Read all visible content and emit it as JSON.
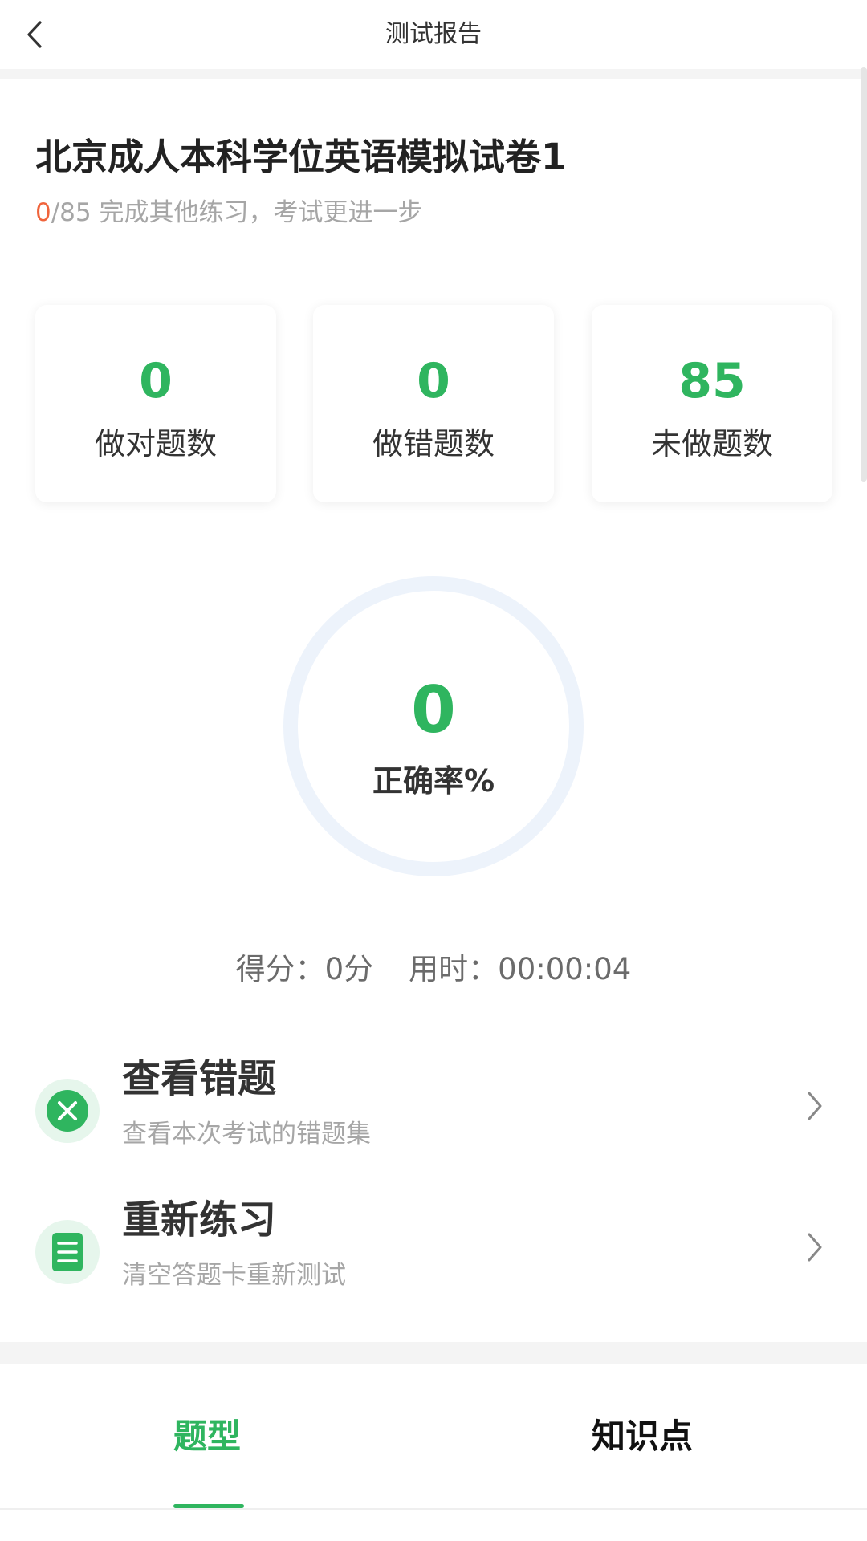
{
  "header": {
    "title": "测试报告"
  },
  "exam": {
    "title": "北京成人本科学位英语模拟试卷1",
    "completed": "0",
    "total_part": "/85",
    "progress_hint": " 完成其他练习，考试更进一步"
  },
  "stats": [
    {
      "value": "0",
      "label": "做对题数"
    },
    {
      "value": "0",
      "label": "做错题数"
    },
    {
      "value": "85",
      "label": "未做题数"
    }
  ],
  "accuracy": {
    "value": "0",
    "label": "正确率%",
    "fraction": 0
  },
  "score": {
    "text": "得分：0分",
    "time_text": "用时：00:00:04"
  },
  "actions": [
    {
      "title": "查看错题",
      "subtitle": "查看本次考试的错题集",
      "icon": "close-circle-icon"
    },
    {
      "title": "重新练习",
      "subtitle": "清空答题卡重新测试",
      "icon": "document-icon"
    }
  ],
  "tabs": [
    {
      "label": "题型",
      "active": true
    },
    {
      "label": "知识点",
      "active": false
    }
  ],
  "colors": {
    "accent": "#2fb55f",
    "highlight": "#f0643c",
    "ring_track": "#edf3fb"
  }
}
